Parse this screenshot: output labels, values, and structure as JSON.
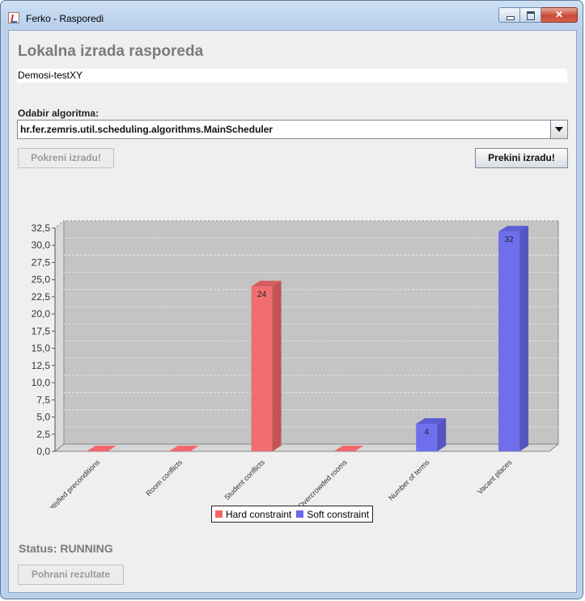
{
  "window": {
    "title": "Ferko - Rasporedi"
  },
  "heading": "Lokalna izrada rasporeda",
  "schedule_name": "Demosi-testXY",
  "algorithm": {
    "label": "Odabir algoritma:",
    "selected": "hr.fer.zemris.util.scheduling.algorithms.MainScheduler"
  },
  "buttons": {
    "start": "Pokreni izradu!",
    "stop": "Prekini izradu!",
    "save": "Pohrani rezultate"
  },
  "status": "Status: RUNNING",
  "colors": {
    "hard": "#f2686b",
    "soft": "#6a6af0",
    "plot_bg": "#c4c4c4"
  },
  "chart_data": {
    "type": "bar",
    "categories": [
      "Unsatisfied preconditions",
      "Room conflicts",
      "Student conflicts",
      "Overcrowded rooms",
      "Number of terms",
      "Vacant places"
    ],
    "series": [
      {
        "name": "Hard constraint",
        "values": [
          0,
          0,
          24,
          0,
          null,
          null
        ]
      },
      {
        "name": "Soft constraint",
        "values": [
          null,
          null,
          null,
          null,
          4,
          32
        ]
      }
    ],
    "data_labels": [
      "",
      "",
      "24",
      "",
      "4",
      "32"
    ],
    "yticks": [
      "0,0",
      "2,5",
      "5,0",
      "7,5",
      "10,0",
      "12,5",
      "15,0",
      "17,5",
      "20,0",
      "22,5",
      "25,0",
      "27,5",
      "30,0",
      "32,5"
    ],
    "ylim": [
      0,
      32.5
    ],
    "grid": true,
    "legend": "bottom-center"
  }
}
